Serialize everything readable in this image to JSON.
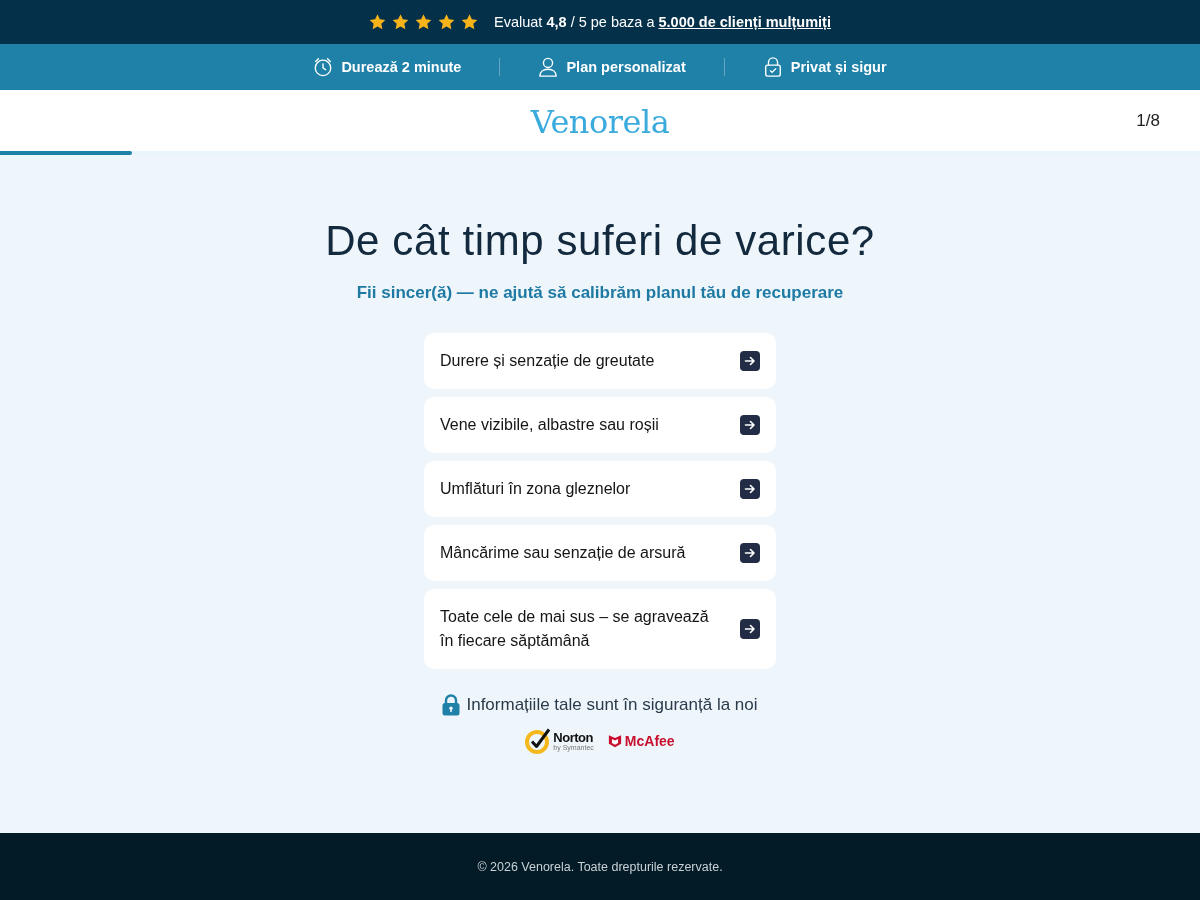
{
  "rating_bar": {
    "stars": 5,
    "text": "Evaluat **4,8** / 5 pe baza a",
    "link": "5.000 de clienți mulțumiți"
  },
  "features": [
    {
      "label": "Durează 2 minute"
    },
    {
      "label": "Plan personalizat"
    },
    {
      "label": "Privat și sigur"
    }
  ],
  "header": {
    "logo": "Venorela",
    "step": "1/8",
    "progress": {
      "level": 0.11
    }
  },
  "question": {
    "title": "De cât timp suferi de varice?",
    "subtitle": "Fii sincer(ă) — ne ajută să calibrăm planul tău de recuperare",
    "options": [
      "Durere și senzație de greutate",
      "Vene vizibile, albastre sau roșii",
      "Umflături în zona gleznelor",
      "Mâncărime sau senzație de arsură",
      "Toate cele de mai sus – se agravează în fiecare săptămână"
    ]
  },
  "trust": {
    "text": "Informațiile tale sunt în siguranță la noi",
    "norton": {
      "name": "Norton",
      "tagline": "by Symantec"
    },
    "mcafee": {
      "name": "McAfee"
    }
  },
  "footer": {
    "text": "© 2026 Venorela. Toate drepturile rezervate."
  }
}
